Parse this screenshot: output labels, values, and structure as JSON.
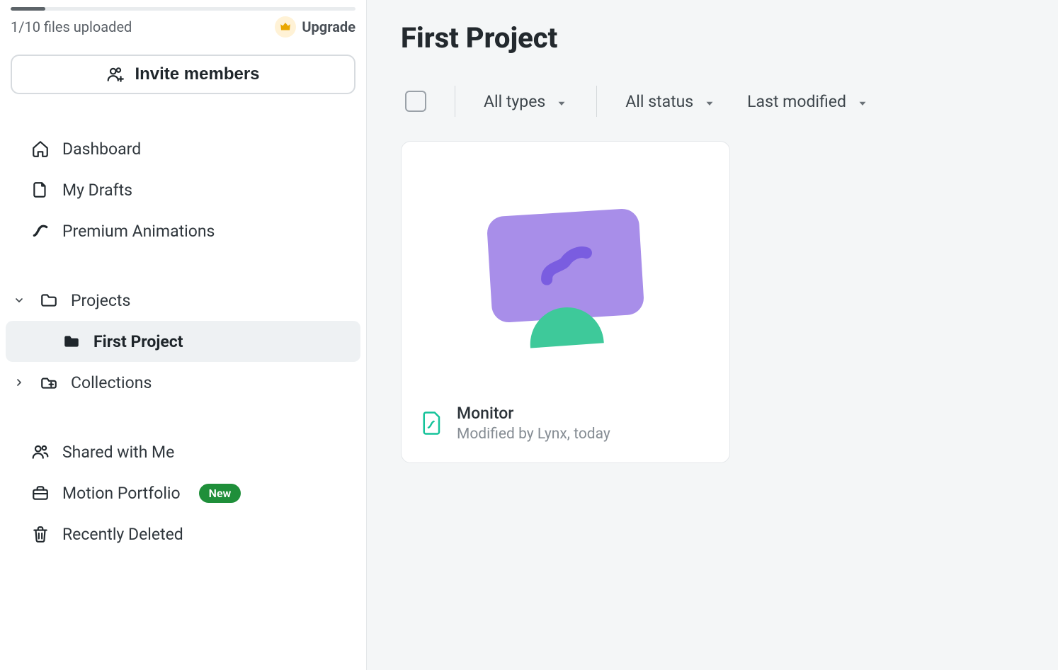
{
  "sidebar": {
    "upload_text": "1/10 files uploaded",
    "upgrade_label": "Upgrade",
    "invite_label": "Invite members",
    "nav": {
      "dashboard": "Dashboard",
      "mydrafts": "My Drafts",
      "premium": "Premium Animations",
      "projects": "Projects",
      "first_project": "First Project",
      "collections": "Collections",
      "shared": "Shared with Me",
      "portfolio": "Motion Portfolio",
      "portfolio_badge": "New",
      "deleted": "Recently Deleted"
    }
  },
  "main": {
    "title": "First Project",
    "filters": {
      "types": "All types",
      "status": "All status",
      "sort": "Last modified"
    },
    "card": {
      "title": "Monitor",
      "subtitle": "Modified by Lynx,  today"
    }
  },
  "colors": {
    "accent_purple": "#a88ee9",
    "accent_purple_dark": "#7a5de0",
    "accent_green": "#3ec99a",
    "badge_green": "#1f8f3a",
    "crown_bg": "#fff2d6",
    "crown_fg": "#e9a700"
  }
}
